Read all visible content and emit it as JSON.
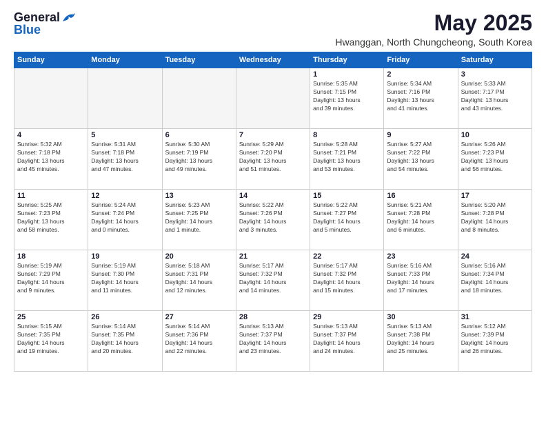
{
  "logo": {
    "general": "General",
    "blue": "Blue"
  },
  "title": "May 2025",
  "subtitle": "Hwanggan, North Chungcheong, South Korea",
  "days_of_week": [
    "Sunday",
    "Monday",
    "Tuesday",
    "Wednesday",
    "Thursday",
    "Friday",
    "Saturday"
  ],
  "weeks": [
    [
      {
        "day": "",
        "info": ""
      },
      {
        "day": "",
        "info": ""
      },
      {
        "day": "",
        "info": ""
      },
      {
        "day": "",
        "info": ""
      },
      {
        "day": "1",
        "info": "Sunrise: 5:35 AM\nSunset: 7:15 PM\nDaylight: 13 hours\nand 39 minutes."
      },
      {
        "day": "2",
        "info": "Sunrise: 5:34 AM\nSunset: 7:16 PM\nDaylight: 13 hours\nand 41 minutes."
      },
      {
        "day": "3",
        "info": "Sunrise: 5:33 AM\nSunset: 7:17 PM\nDaylight: 13 hours\nand 43 minutes."
      }
    ],
    [
      {
        "day": "4",
        "info": "Sunrise: 5:32 AM\nSunset: 7:18 PM\nDaylight: 13 hours\nand 45 minutes."
      },
      {
        "day": "5",
        "info": "Sunrise: 5:31 AM\nSunset: 7:18 PM\nDaylight: 13 hours\nand 47 minutes."
      },
      {
        "day": "6",
        "info": "Sunrise: 5:30 AM\nSunset: 7:19 PM\nDaylight: 13 hours\nand 49 minutes."
      },
      {
        "day": "7",
        "info": "Sunrise: 5:29 AM\nSunset: 7:20 PM\nDaylight: 13 hours\nand 51 minutes."
      },
      {
        "day": "8",
        "info": "Sunrise: 5:28 AM\nSunset: 7:21 PM\nDaylight: 13 hours\nand 53 minutes."
      },
      {
        "day": "9",
        "info": "Sunrise: 5:27 AM\nSunset: 7:22 PM\nDaylight: 13 hours\nand 54 minutes."
      },
      {
        "day": "10",
        "info": "Sunrise: 5:26 AM\nSunset: 7:23 PM\nDaylight: 13 hours\nand 56 minutes."
      }
    ],
    [
      {
        "day": "11",
        "info": "Sunrise: 5:25 AM\nSunset: 7:23 PM\nDaylight: 13 hours\nand 58 minutes."
      },
      {
        "day": "12",
        "info": "Sunrise: 5:24 AM\nSunset: 7:24 PM\nDaylight: 14 hours\nand 0 minutes."
      },
      {
        "day": "13",
        "info": "Sunrise: 5:23 AM\nSunset: 7:25 PM\nDaylight: 14 hours\nand 1 minute."
      },
      {
        "day": "14",
        "info": "Sunrise: 5:22 AM\nSunset: 7:26 PM\nDaylight: 14 hours\nand 3 minutes."
      },
      {
        "day": "15",
        "info": "Sunrise: 5:22 AM\nSunset: 7:27 PM\nDaylight: 14 hours\nand 5 minutes."
      },
      {
        "day": "16",
        "info": "Sunrise: 5:21 AM\nSunset: 7:28 PM\nDaylight: 14 hours\nand 6 minutes."
      },
      {
        "day": "17",
        "info": "Sunrise: 5:20 AM\nSunset: 7:28 PM\nDaylight: 14 hours\nand 8 minutes."
      }
    ],
    [
      {
        "day": "18",
        "info": "Sunrise: 5:19 AM\nSunset: 7:29 PM\nDaylight: 14 hours\nand 9 minutes."
      },
      {
        "day": "19",
        "info": "Sunrise: 5:19 AM\nSunset: 7:30 PM\nDaylight: 14 hours\nand 11 minutes."
      },
      {
        "day": "20",
        "info": "Sunrise: 5:18 AM\nSunset: 7:31 PM\nDaylight: 14 hours\nand 12 minutes."
      },
      {
        "day": "21",
        "info": "Sunrise: 5:17 AM\nSunset: 7:32 PM\nDaylight: 14 hours\nand 14 minutes."
      },
      {
        "day": "22",
        "info": "Sunrise: 5:17 AM\nSunset: 7:32 PM\nDaylight: 14 hours\nand 15 minutes."
      },
      {
        "day": "23",
        "info": "Sunrise: 5:16 AM\nSunset: 7:33 PM\nDaylight: 14 hours\nand 17 minutes."
      },
      {
        "day": "24",
        "info": "Sunrise: 5:16 AM\nSunset: 7:34 PM\nDaylight: 14 hours\nand 18 minutes."
      }
    ],
    [
      {
        "day": "25",
        "info": "Sunrise: 5:15 AM\nSunset: 7:35 PM\nDaylight: 14 hours\nand 19 minutes."
      },
      {
        "day": "26",
        "info": "Sunrise: 5:14 AM\nSunset: 7:35 PM\nDaylight: 14 hours\nand 20 minutes."
      },
      {
        "day": "27",
        "info": "Sunrise: 5:14 AM\nSunset: 7:36 PM\nDaylight: 14 hours\nand 22 minutes."
      },
      {
        "day": "28",
        "info": "Sunrise: 5:13 AM\nSunset: 7:37 PM\nDaylight: 14 hours\nand 23 minutes."
      },
      {
        "day": "29",
        "info": "Sunrise: 5:13 AM\nSunset: 7:37 PM\nDaylight: 14 hours\nand 24 minutes."
      },
      {
        "day": "30",
        "info": "Sunrise: 5:13 AM\nSunset: 7:38 PM\nDaylight: 14 hours\nand 25 minutes."
      },
      {
        "day": "31",
        "info": "Sunrise: 5:12 AM\nSunset: 7:39 PM\nDaylight: 14 hours\nand 26 minutes."
      }
    ]
  ]
}
